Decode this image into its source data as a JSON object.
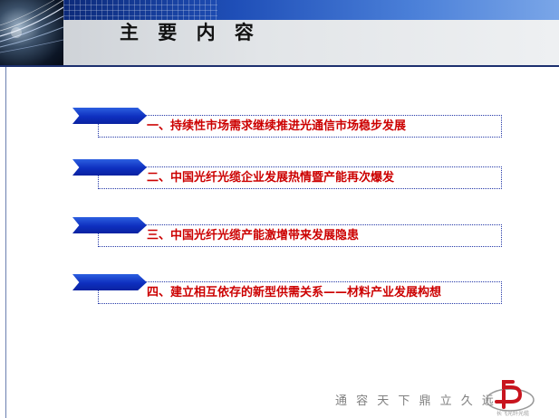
{
  "slide": {
    "title": "主 要 内 容",
    "items": [
      {
        "label": "一、持续性市场需求继续推进光通信市场稳步发展"
      },
      {
        "label": "二、中国光纤光缆企业发展热情暨产能再次爆发"
      },
      {
        "label": "三、中国光纤光缆产能激增带来发展隐患"
      },
      {
        "label": "四、建立相互依存的新型供需关系——材料产业发展构想"
      }
    ]
  },
  "footer": {
    "slogan": "通 容 天 下   鼎 立 久 远",
    "logo_text": "长飞光纤光缆",
    "logo_color": "#c8141e"
  },
  "colors": {
    "accent_red": "#cc0000",
    "arrow_blue": "#0e2fbf",
    "header_blue": "#1f4fb8",
    "header_line": "#1c2f6e"
  }
}
